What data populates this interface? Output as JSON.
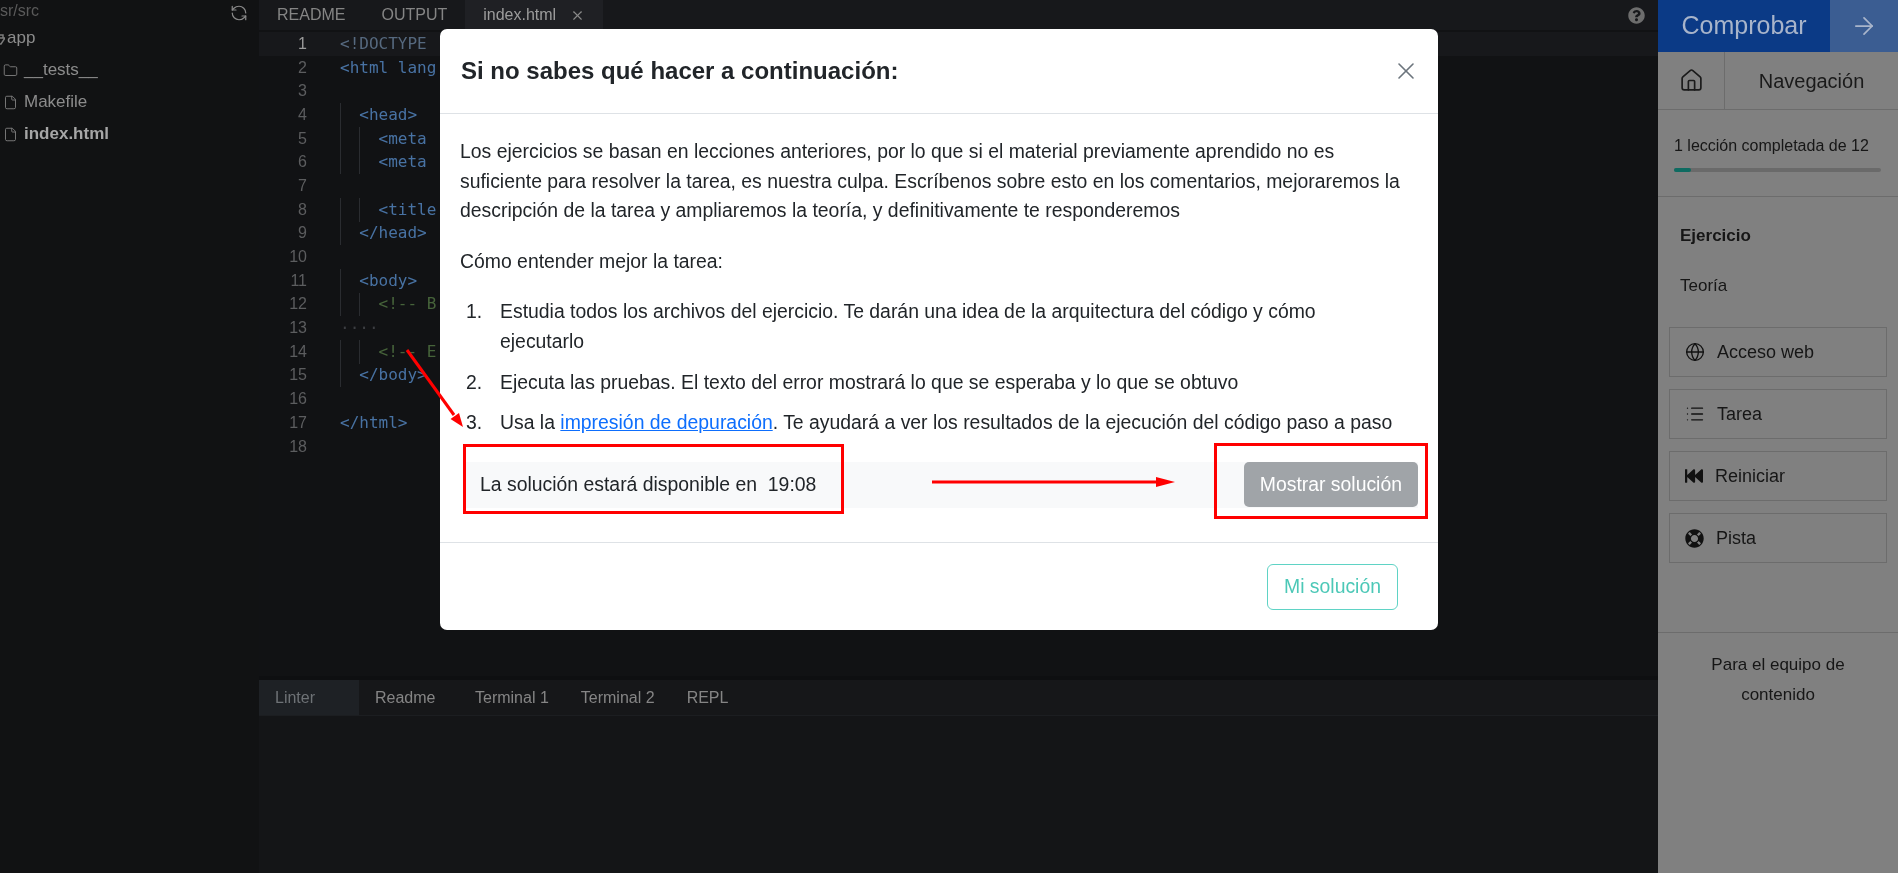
{
  "file_tree": {
    "path": "sr/src",
    "items": [
      {
        "name": "app",
        "kind": "folder",
        "expanded": true,
        "selected": false,
        "children": [
          {
            "name": "__tests__",
            "kind": "folder",
            "expanded": false,
            "selected": false
          },
          {
            "name": "Makefile",
            "kind": "file",
            "selected": false
          },
          {
            "name": "index.html",
            "kind": "file",
            "selected": true
          }
        ]
      }
    ]
  },
  "editor": {
    "tabs": [
      {
        "label": "README",
        "selected": false,
        "closable": false
      },
      {
        "label": "OUTPUT",
        "selected": false,
        "closable": false
      },
      {
        "label": "index.html",
        "selected": true,
        "closable": true
      }
    ],
    "lines": [
      {
        "number": "1",
        "code": "<!DOCTYPE",
        "kind": "doctype",
        "current": true
      },
      {
        "number": "2",
        "code": "<html lang",
        "kind": "tag",
        "current": false
      },
      {
        "number": "3",
        "current": false
      },
      {
        "number": "4",
        "code": "  <head>",
        "kind": "tag",
        "current": false
      },
      {
        "number": "5",
        "code": "    <meta",
        "kind": "tag",
        "current": false
      },
      {
        "number": "6",
        "code": "    <meta",
        "kind": "tag",
        "current": false
      },
      {
        "number": "7",
        "current": false
      },
      {
        "number": "8",
        "code": "    <title",
        "kind": "tag",
        "current": false
      },
      {
        "number": "9",
        "code": "  </head>",
        "kind": "tag",
        "current": false
      },
      {
        "number": "10",
        "current": false
      },
      {
        "number": "11",
        "code": "  <body>",
        "kind": "tag",
        "current": false
      },
      {
        "number": "12",
        "code": "    <!-- B",
        "kind": "comment",
        "current": false
      },
      {
        "number": "13",
        "code": "····",
        "kind": "whitespace",
        "current": false
      },
      {
        "number": "14",
        "code": "    <!-- E",
        "kind": "comment",
        "current": false
      },
      {
        "number": "15",
        "code": "  </body>",
        "kind": "tag",
        "current": false
      },
      {
        "number": "16",
        "current": false
      },
      {
        "number": "17",
        "code": "</html>",
        "kind": "tag",
        "current": false
      },
      {
        "number": "18",
        "current": false
      }
    ]
  },
  "bottom_panel": {
    "tabs": [
      {
        "label": "Linter",
        "selected": true
      },
      {
        "label": "Readme",
        "selected": false
      },
      {
        "label": "Terminal 1",
        "selected": false
      },
      {
        "label": "Terminal 2",
        "selected": false
      },
      {
        "label": "REPL",
        "selected": false
      }
    ]
  },
  "sidebar": {
    "check_button": "Comprobar",
    "navigation": "Navegación",
    "progress": {
      "text": "1 lección completada de 12",
      "level": 0.083
    },
    "sections": [
      {
        "label": "Ejercicio",
        "selected": true
      },
      {
        "label": "Teoría",
        "selected": false
      }
    ],
    "actions": [
      "Acceso web",
      "Tarea",
      "Reiniciar",
      "Pista"
    ],
    "footer": "Para el equipo de contenido"
  },
  "modal": {
    "title": "Si no sabes qué hacer a continuación:",
    "paragraphs": [
      "Los ejercicios se basan en lecciones anteriores, por lo que si el material previamente aprendido no es suficiente para resolver la tarea, es nuestra culpa. Escríbenos sobre esto en los comentarios, mejoraremos la descripción de la tarea y ampliaremos la teoría, y definitivamente te responderemos",
      "Cómo entender mejor la tarea:"
    ],
    "steps": [
      {
        "number": "1.",
        "text": "Estudia todos los archivos del ejercicio. Te darán una idea de la arquitectura del código y cómo ejecutarlo"
      },
      {
        "number": "2.",
        "text": "Ejecuta las pruebas. El texto del error mostrará lo que se esperaba y lo que se obtuvo"
      },
      {
        "number": "3.",
        "text": "Usa la ",
        "link": "impresión de depuración",
        "text_after": ". Te ayudará a ver los resultados de la ejecución del código paso a paso"
      }
    ],
    "solution": {
      "text": "La solución estará disponible en  19:08",
      "button": {
        "label": "Mostrar solución",
        "disabled": true
      }
    },
    "footer_button": "Mi solución"
  }
}
